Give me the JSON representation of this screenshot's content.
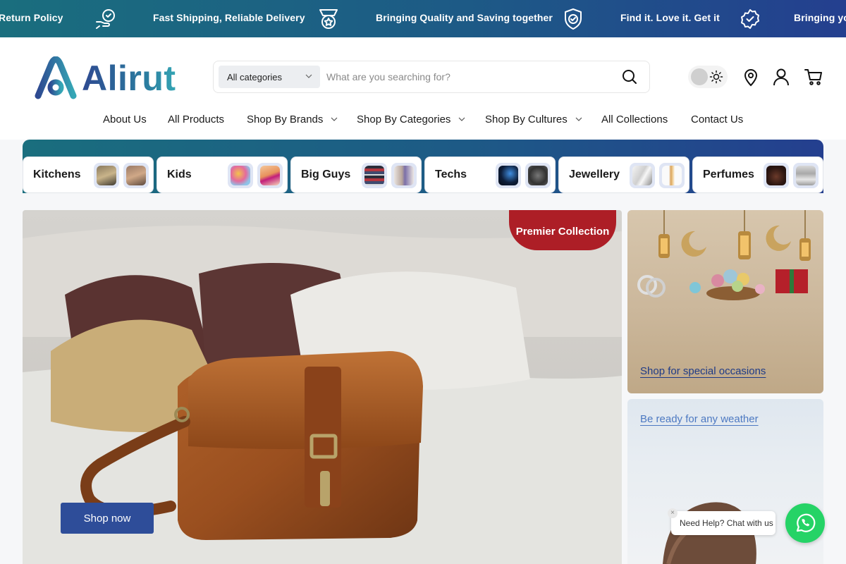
{
  "announcement": {
    "items": [
      {
        "text": "Return Policy",
        "icon": "none"
      },
      {
        "text": "Fast Shipping, Reliable Delivery",
        "icon": "support-hand-icon"
      },
      {
        "text": "Bringing Quality and Saving together",
        "icon": "medal-icon"
      },
      {
        "text": "Find it. Love it. Get it",
        "icon": "shield-check-icon"
      },
      {
        "text": "Bringing yo",
        "icon": "badge-check-icon"
      }
    ]
  },
  "header": {
    "logo_text": "Alirut",
    "search": {
      "category_label": "All categories",
      "placeholder": "What are you searching for?"
    },
    "icons": [
      "theme-toggle",
      "location-pin-icon",
      "account-icon",
      "cart-icon"
    ]
  },
  "nav": {
    "items": [
      {
        "label": "About Us",
        "dropdown": false
      },
      {
        "label": "All Products",
        "dropdown": false
      },
      {
        "label": "Shop By Brands",
        "dropdown": true
      },
      {
        "label": "Shop By Categories",
        "dropdown": true
      },
      {
        "label": "Shop By Cultures",
        "dropdown": true
      },
      {
        "label": "All Collections",
        "dropdown": false
      },
      {
        "label": "Contact Us",
        "dropdown": false
      }
    ]
  },
  "categories": [
    {
      "name": "Kitchens"
    },
    {
      "name": "Kids"
    },
    {
      "name": "Big Guys"
    },
    {
      "name": "Techs"
    },
    {
      "name": "Jewellery"
    },
    {
      "name": "Perfumes"
    }
  ],
  "hero": {
    "tag": "Premier Collection",
    "cta": "Shop now"
  },
  "promos": [
    {
      "link": "Shop for special occasions"
    },
    {
      "link": "Be ready for any weather"
    }
  ],
  "chat": {
    "text": "Need Help? Chat with us",
    "close": "×"
  },
  "colors": {
    "brand_blue": "#2e4d99",
    "teal": "#1a6e7e",
    "tag_red": "#ad1e26",
    "whatsapp": "#25d366"
  }
}
